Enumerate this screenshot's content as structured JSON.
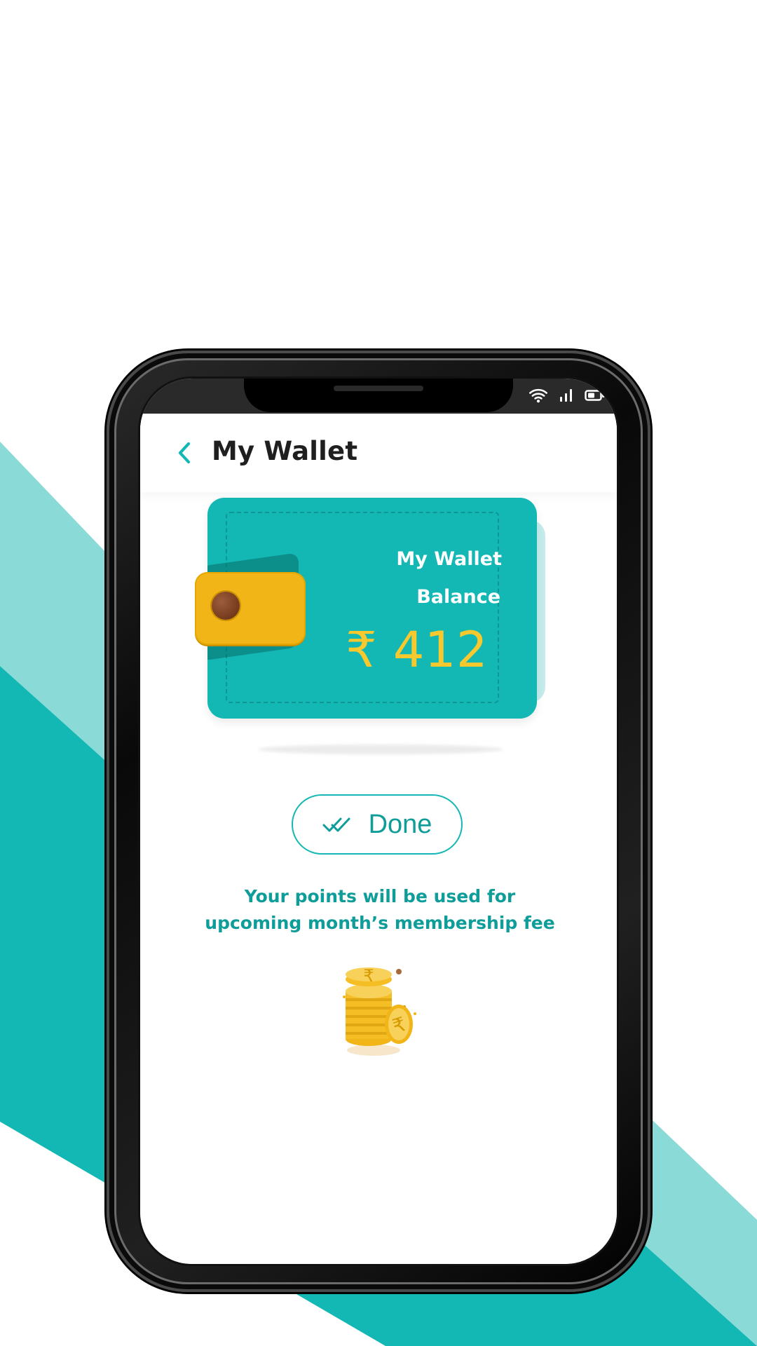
{
  "app": {
    "title": "My Wallet"
  },
  "wallet": {
    "line1": "My Wallet",
    "line2": "Balance",
    "currency_symbol": "₹",
    "amount": "412",
    "amount_display": "₹ 412"
  },
  "actions": {
    "done_label": "Done"
  },
  "note": {
    "text": "Your points will be used for upcoming month’s membership fee"
  },
  "icons": {
    "back": "chevron-left-icon",
    "done": "double-check-icon",
    "coins": "rupee-coins-icon",
    "wifi": "wifi-icon",
    "signal": "signal-icon",
    "battery": "battery-icon"
  },
  "colors": {
    "teal": "#13B8B4",
    "teal_dark": "#0F9D9A",
    "teal_light": "#8ADBD7",
    "gold": "#F2B518",
    "white": "#FFFFFF"
  }
}
